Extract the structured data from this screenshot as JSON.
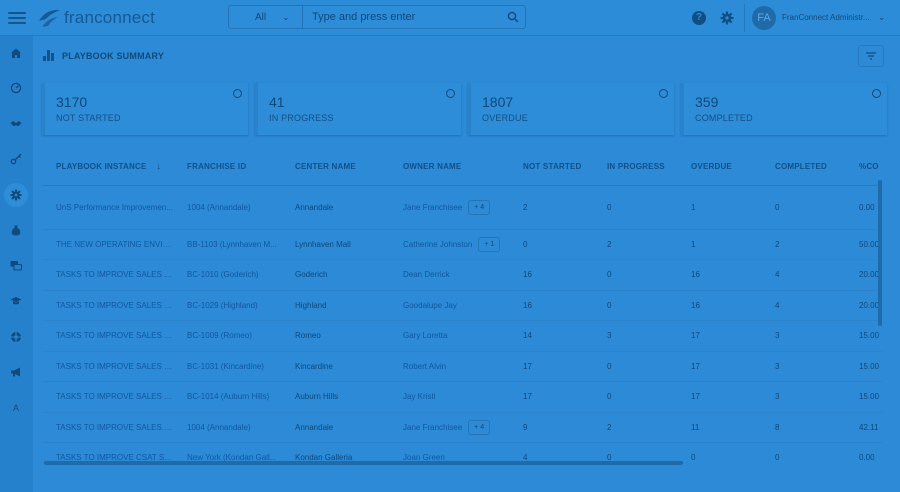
{
  "header": {
    "brand": "franconnect",
    "search": {
      "scope": "All",
      "placeholder": "Type and press enter"
    },
    "user": {
      "initials": "FA",
      "name": "FranConnect Administr..."
    }
  },
  "sidebar": {
    "items": [
      {
        "icon": "home-icon"
      },
      {
        "icon": "dashboard-icon"
      },
      {
        "icon": "handshake-icon"
      },
      {
        "icon": "key-icon"
      },
      {
        "icon": "gear-icon",
        "active": true
      },
      {
        "icon": "money-bag-icon"
      },
      {
        "icon": "chat-icon"
      },
      {
        "icon": "graduation-cap-icon"
      },
      {
        "icon": "support-icon"
      },
      {
        "icon": "megaphone-icon"
      },
      {
        "label": "A"
      }
    ]
  },
  "page": {
    "title": "PLAYBOOK SUMMARY"
  },
  "cards": [
    {
      "value": "3170",
      "label": "NOT STARTED"
    },
    {
      "value": "41",
      "label": "IN PROGRESS"
    },
    {
      "value": "1807",
      "label": "OVERDUE"
    },
    {
      "value": "359",
      "label": "COMPLETED"
    }
  ],
  "table": {
    "columns": [
      "PLAYBOOK INSTANCE",
      "FRANCHISE ID",
      "CENTER NAME",
      "OWNER NAME",
      "NOT STARTED",
      "IN PROGRESS",
      "OVERDUE",
      "COMPLETED",
      "%CO"
    ],
    "rows": [
      {
        "instance": "UnS Performance Improvemen...",
        "franchise": "1004 (Annandale)",
        "center": "Annandale",
        "owner": "Jane Franchisee",
        "more": "+ 4",
        "not_started": "2",
        "in_progress": "0",
        "overdue": "1",
        "completed": "0",
        "pct": "0.00"
      },
      {
        "instance": "THE NEW OPERATING ENVIRO...",
        "franchise": "BB-1103 (Lynnhaven M...",
        "center": "Lynnhaven Mall",
        "owner": "Catherine Johnston",
        "more": "+ 1",
        "not_started": "0",
        "in_progress": "2",
        "overdue": "1",
        "completed": "2",
        "pct": "50.00"
      },
      {
        "instance": "TASKS TO IMPROVE SALES MAR...",
        "franchise": "BC-1010 (Goderich)",
        "center": "Goderich",
        "owner": "Dean Derrick",
        "more": "",
        "not_started": "16",
        "in_progress": "0",
        "overdue": "16",
        "completed": "4",
        "pct": "20.00"
      },
      {
        "instance": "TASKS TO IMPROVE SALES MAR...",
        "franchise": "BC-1029 (Highland)",
        "center": "Highland",
        "owner": "Goodalupe Jay",
        "more": "",
        "not_started": "16",
        "in_progress": "0",
        "overdue": "16",
        "completed": "4",
        "pct": "20.00"
      },
      {
        "instance": "TASKS TO IMPROVE SALES MAR...",
        "franchise": "BC-1009 (Romeo)",
        "center": "Romeo",
        "owner": "Gary Loretta",
        "more": "",
        "not_started": "14",
        "in_progress": "3",
        "overdue": "17",
        "completed": "3",
        "pct": "15.00"
      },
      {
        "instance": "TASKS TO IMPROVE SALES MAR...",
        "franchise": "BC-1031 (Kincardine)",
        "center": "Kincardine",
        "owner": "Robert Alvin",
        "more": "",
        "not_started": "17",
        "in_progress": "0",
        "overdue": "17",
        "completed": "3",
        "pct": "15.00"
      },
      {
        "instance": "TASKS TO IMPROVE SALES MAR...",
        "franchise": "BC-1014 (Auburn Hills)",
        "center": "Auburn Hills",
        "owner": "Jay Kristi",
        "more": "",
        "not_started": "17",
        "in_progress": "0",
        "overdue": "17",
        "completed": "3",
        "pct": "15.00"
      },
      {
        "instance": "TASKS TO IMPROVE SALES MAR...",
        "franchise": "1004 (Annandale)",
        "center": "Annandale",
        "owner": "Jane Franchisee",
        "more": "+ 4",
        "not_started": "9",
        "in_progress": "2",
        "overdue": "11",
        "completed": "8",
        "pct": "42.11"
      },
      {
        "instance": "TASKS TO IMPROVE CSAT SCOR...",
        "franchise": "New York (Kondan Gall...",
        "center": "Kondan Galleria",
        "owner": "Joan Green",
        "more": "",
        "not_started": "4",
        "in_progress": "0",
        "overdue": "0",
        "completed": "0",
        "pct": "0.00"
      }
    ]
  },
  "colors": {
    "overlay": "#2c8ad6",
    "text": "#0f497b",
    "link": "#1258a0"
  }
}
